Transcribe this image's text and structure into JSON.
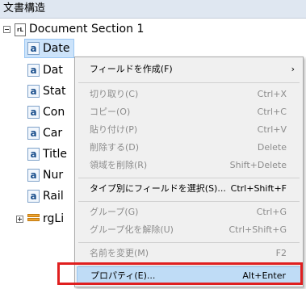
{
  "panel": {
    "title": "文書構造"
  },
  "tree": {
    "root_label": "Document Section 1",
    "root_icon": "rL",
    "field_icon": "a",
    "items": [
      "Date",
      "Dat",
      "Stat",
      "Con",
      "Car",
      "Title",
      "Nur",
      "Rail"
    ],
    "group_label": "rgLi"
  },
  "menu": {
    "items": [
      {
        "label": "フィールドを作成(F)",
        "shortcut": "",
        "submenu": true,
        "disabled": false
      },
      {
        "label": "切り取り(C)",
        "shortcut": "Ctrl+X",
        "disabled": true
      },
      {
        "label": "コピー(O)",
        "shortcut": "Ctrl+C",
        "disabled": true
      },
      {
        "label": "貼り付け(P)",
        "shortcut": "Ctrl+V",
        "disabled": true
      },
      {
        "label": "削除する(D)",
        "shortcut": "Delete",
        "disabled": true
      },
      {
        "label": "領域を削除(R)",
        "shortcut": "Shift+Delete",
        "disabled": true
      },
      {
        "label": "タイプ別にフィールドを選択(S)...",
        "shortcut": "Ctrl+Shift+F",
        "disabled": false
      },
      {
        "label": "グループ(G)",
        "shortcut": "Ctrl+G",
        "disabled": true
      },
      {
        "label": "グループ化を解除(U)",
        "shortcut": "Ctrl+Shift+G",
        "disabled": true
      },
      {
        "label": "名前を変更(M)",
        "shortcut": "F2",
        "disabled": true
      },
      {
        "label": "プロパティ(E)...",
        "shortcut": "Alt+Enter",
        "disabled": false,
        "highlighted": true
      }
    ],
    "submenu_arrow": "›"
  },
  "colors": {
    "highlight_box": "#e01f1f",
    "selection": "#cce3fa"
  }
}
